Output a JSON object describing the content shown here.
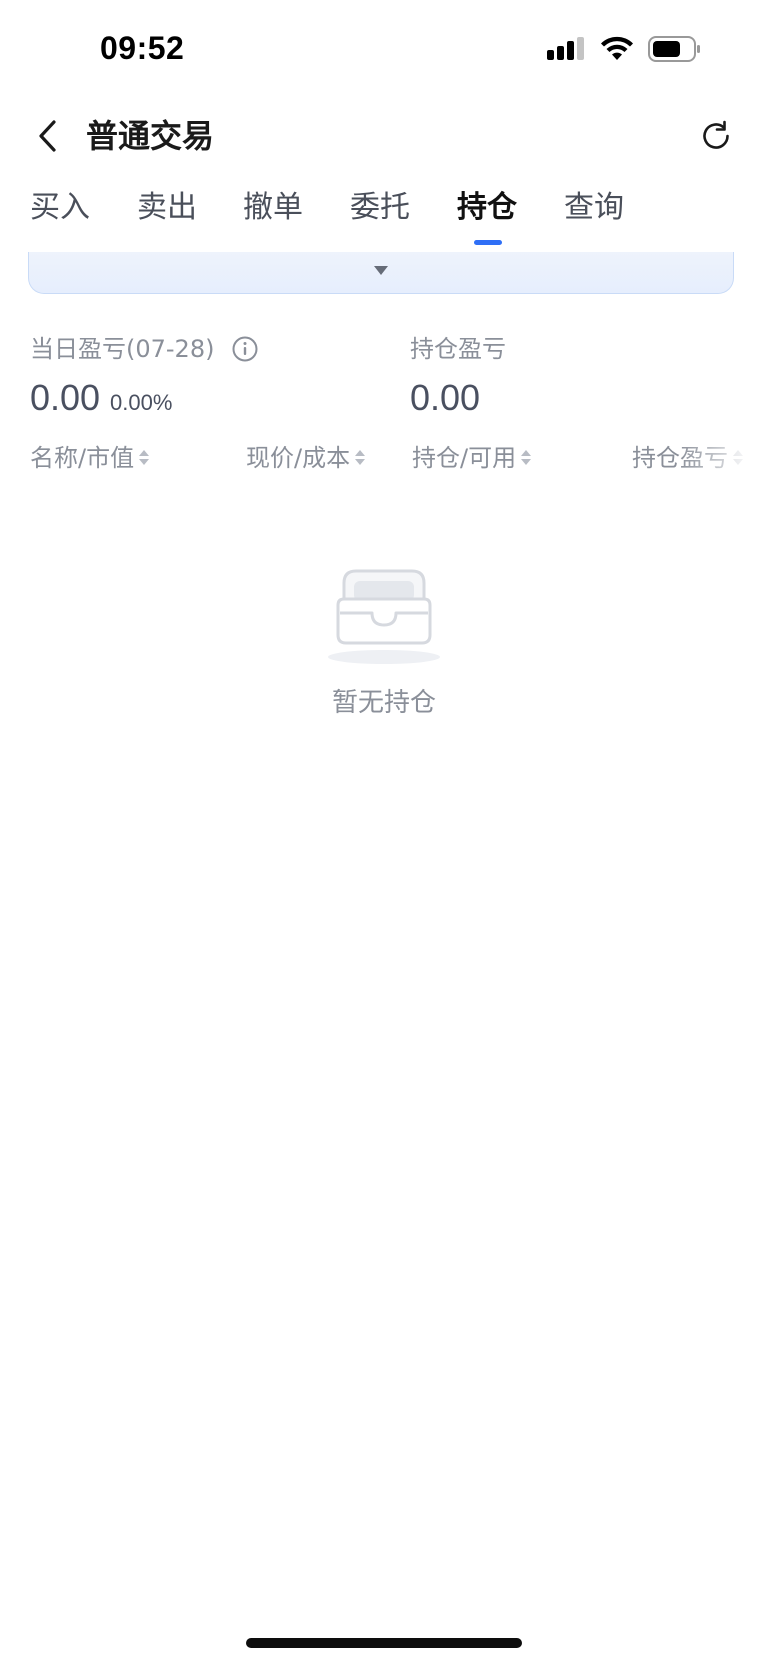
{
  "status_bar": {
    "time": "09:52"
  },
  "header": {
    "title": "普通交易"
  },
  "tabs": [
    {
      "label": "买入"
    },
    {
      "label": "卖出"
    },
    {
      "label": "撤单"
    },
    {
      "label": "委托"
    },
    {
      "label": "持仓",
      "active": true
    },
    {
      "label": "查询"
    }
  ],
  "summary": {
    "daily_pnl_label": "当日盈亏(07-28)",
    "daily_pnl_value": "0.00",
    "daily_pnl_pct": "0.00%",
    "position_pnl_label": "持仓盈亏",
    "position_pnl_value": "0.00"
  },
  "table": {
    "columns": [
      "名称/市值",
      "现价/成本",
      "持仓/可用",
      "持仓盈亏"
    ]
  },
  "empty_state": {
    "text": "暂无持仓"
  },
  "colors": {
    "accent": "#2f6ff6",
    "muted_text": "#8a8f99",
    "value_text": "#4a5060"
  }
}
